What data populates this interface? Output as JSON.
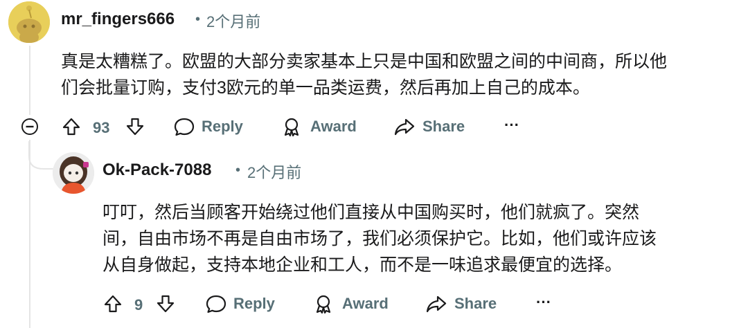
{
  "comments": [
    {
      "username": "mr_fingers666",
      "separator": "•",
      "time": "2个月前",
      "text_lines": [
        "真是太糟糕了。欧盟的大部分卖家基本上只是中国和欧盟之间的中间商，所以他",
        "们会批量订购，支付3欧元的单一品类运费，然后再加上自己的成本。"
      ],
      "votes": "93",
      "reply_label": "Reply",
      "award_label": "Award",
      "share_label": "Share",
      "more_label": "···"
    },
    {
      "username": "Ok-Pack-7088",
      "separator": "•",
      "time": "2个月前",
      "text_lines": [
        "叮叮，然后当顾客开始绕过他们直接从中国购买时，他们就疯了。突然",
        "间，自由市场不再是自由市场了，我们必须保护它。比如，他们或许应该",
        "从自身做起，支持本地企业和工人，而不是一味追求最便宜的选择。"
      ],
      "votes": "9",
      "reply_label": "Reply",
      "award_label": "Award",
      "share_label": "Share",
      "more_label": "···"
    }
  ],
  "colors": {
    "meta": "#576f76",
    "text": "#1a1a1b",
    "thread_line": "#e5e5e5"
  },
  "icons": [
    "upvote-icon",
    "downvote-icon",
    "reply-icon",
    "award-icon",
    "share-icon",
    "collapse-icon",
    "more-icon"
  ]
}
